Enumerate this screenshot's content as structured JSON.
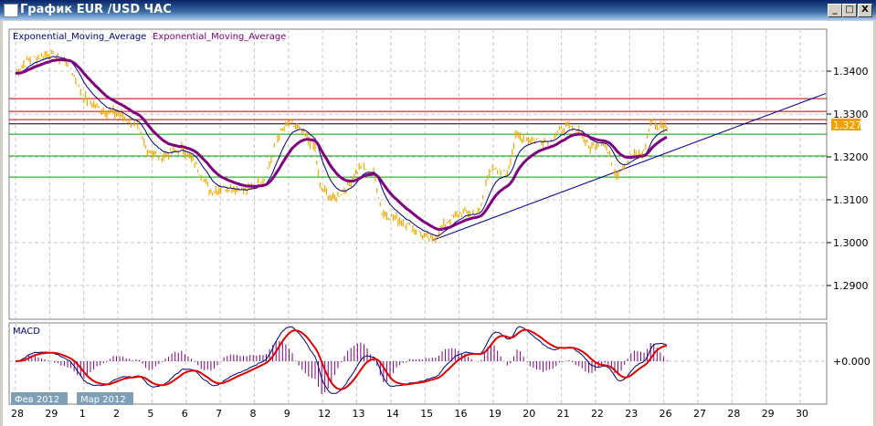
{
  "window": {
    "title": "График EUR /USD  ЧАС",
    "min_label": "_",
    "max_label": "□",
    "close_label": "X"
  },
  "legend": {
    "ema1": "Exponential_Moving_Average",
    "ema2": "Exponential_Moving_Average",
    "macd": "MACD"
  },
  "colors": {
    "price": "#f0a800",
    "ema_fast": "#000080",
    "ema_slow": "#800080",
    "macd_signal": "#e00000",
    "trend": "#0000a0",
    "red_level": "#c00000",
    "green_level": "#00a000",
    "badge": "#f0a000"
  },
  "price_axis": [
    "1.3400",
    "1.3300",
    "1.3200",
    "1.3100",
    "1.3000",
    "1.2900"
  ],
  "current_price": "1.3272",
  "macd_axis": "+0.000",
  "month_labels": [
    "Фев 2012",
    "Мар 2012"
  ],
  "time_axis": [
    "28",
    "29",
    "1",
    "2",
    "5",
    "6",
    "7",
    "8",
    "9",
    "12",
    "13",
    "14",
    "15",
    "16",
    "19",
    "20",
    "21",
    "22",
    "23",
    "26",
    "27",
    "28",
    "29",
    "30"
  ],
  "chart_data": {
    "type": "line",
    "symbol": "EUR/USD",
    "timeframe": "H1",
    "ylim": [
      1.286,
      1.3475
    ],
    "price_points": [
      [
        0,
        1.3395
      ],
      [
        0.35,
        1.3425
      ],
      [
        0.96,
        1.344
      ],
      [
        1.55,
        1.342
      ],
      [
        1.98,
        1.334
      ],
      [
        2.49,
        1.331
      ],
      [
        3.03,
        1.33
      ],
      [
        3.56,
        1.327
      ],
      [
        3.83,
        1.322
      ],
      [
        4.23,
        1.32
      ],
      [
        4.9,
        1.322
      ],
      [
        5.3,
        1.318
      ],
      [
        5.7,
        1.312
      ],
      [
        6.24,
        1.313
      ],
      [
        6.77,
        1.312
      ],
      [
        7.31,
        1.315
      ],
      [
        7.71,
        1.325
      ],
      [
        8.03,
        1.328
      ],
      [
        8.38,
        1.326
      ],
      [
        8.78,
        1.322
      ],
      [
        8.92,
        1.313
      ],
      [
        9.32,
        1.31
      ],
      [
        9.72,
        1.313
      ],
      [
        10.12,
        1.318
      ],
      [
        10.52,
        1.316
      ],
      [
        10.74,
        1.307
      ],
      [
        11.33,
        1.305
      ],
      [
        11.86,
        1.302
      ],
      [
        12.21,
        1.3005
      ],
      [
        12.66,
        1.305
      ],
      [
        13.07,
        1.307
      ],
      [
        13.6,
        1.307
      ],
      [
        13.87,
        1.317
      ],
      [
        14.4,
        1.316
      ],
      [
        14.67,
        1.325
      ],
      [
        15.07,
        1.324
      ],
      [
        15.61,
        1.324
      ],
      [
        16.14,
        1.327
      ],
      [
        16.55,
        1.326
      ],
      [
        16.81,
        1.322
      ],
      [
        17.22,
        1.324
      ],
      [
        17.62,
        1.316
      ],
      [
        18.02,
        1.32
      ],
      [
        18.42,
        1.321
      ],
      [
        18.61,
        1.328
      ],
      [
        18.82,
        1.327
      ],
      [
        19.09,
        1.3272
      ]
    ],
    "levels": {
      "red": [
        1.3336,
        1.3306,
        1.3287
      ],
      "black": [
        1.3277
      ],
      "green": [
        1.3253,
        1.3202,
        1.3153
      ]
    },
    "trendline": [
      [
        12.21,
        1.3005
      ],
      [
        23.75,
        1.3348
      ]
    ]
  }
}
